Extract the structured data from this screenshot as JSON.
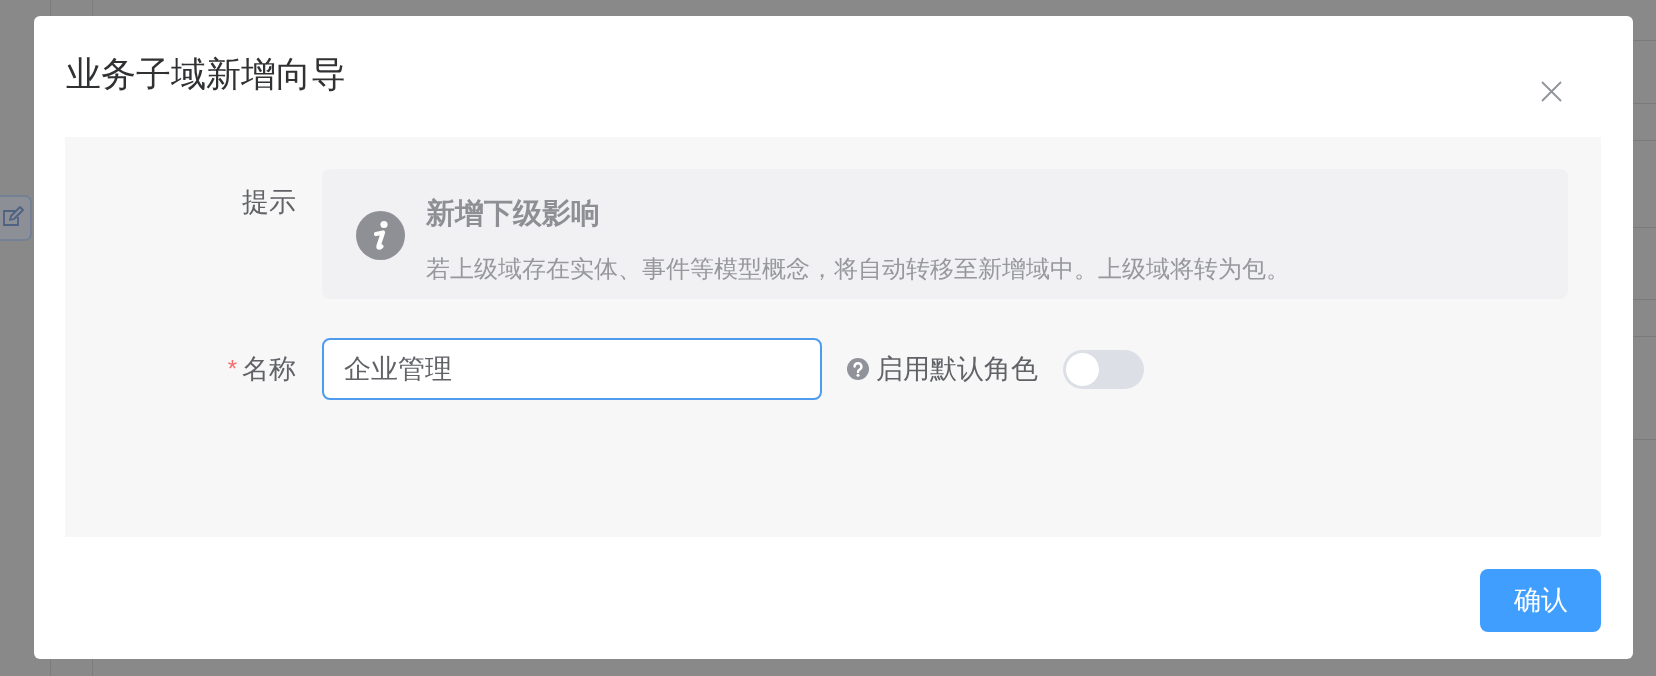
{
  "dialog": {
    "title": "业务子域新增向导"
  },
  "tip": {
    "label": "提示",
    "title": "新增下级影响",
    "text": "若上级域存在实体、事件等模型概念，将自动转移至新增域中。上级域将转为包。"
  },
  "name_field": {
    "required_mark": "*",
    "label": "名称",
    "value": "企业管理",
    "focused": true
  },
  "default_role_switch": {
    "label": "启用默认角色",
    "on": false
  },
  "buttons": [
    {
      "label": "确认",
      "kind": "primary"
    }
  ]
}
